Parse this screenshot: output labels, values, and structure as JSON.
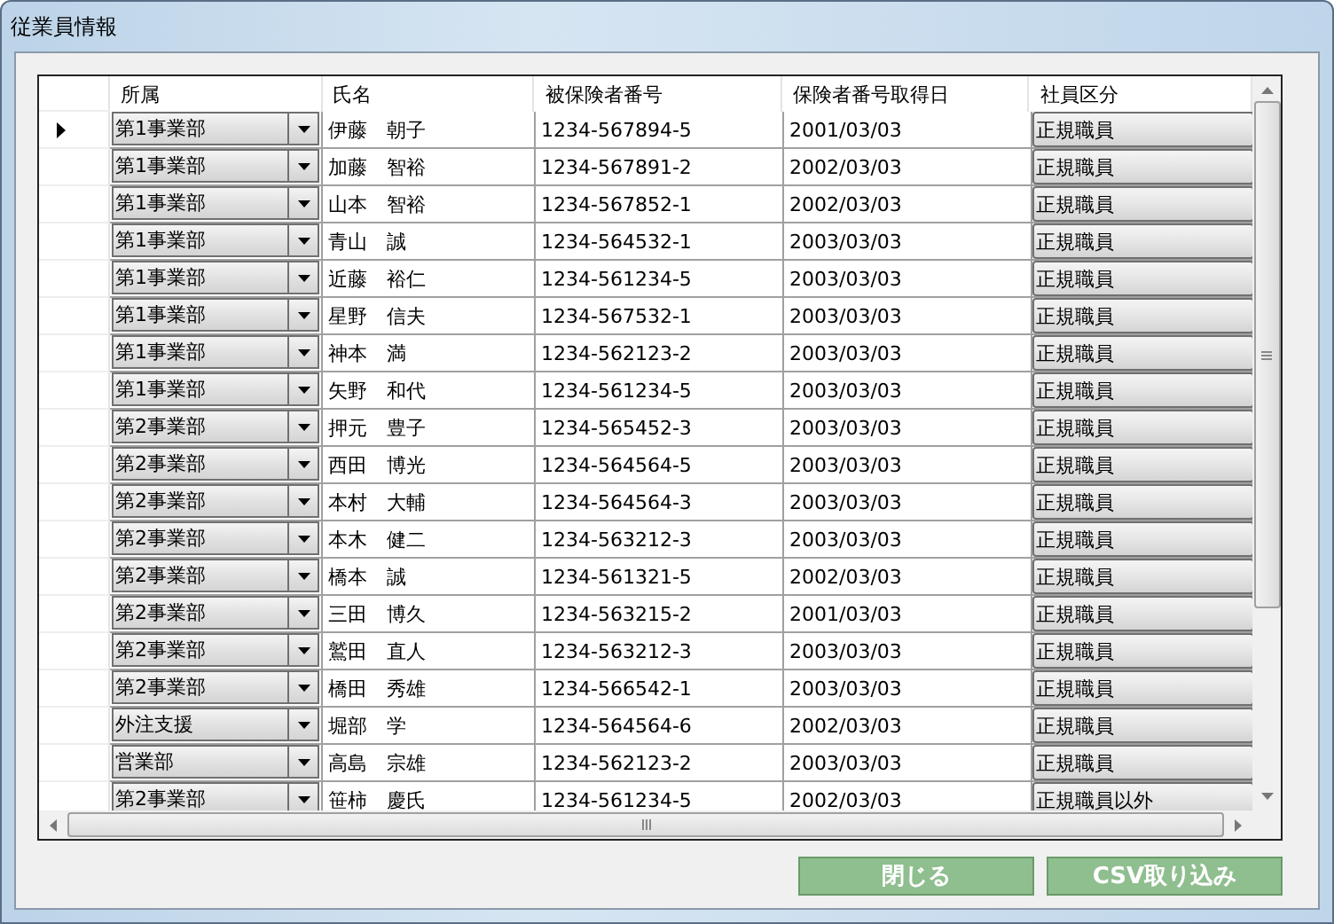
{
  "window": {
    "title": "従業員情報"
  },
  "grid": {
    "columns": [
      "所属",
      "氏名",
      "被保険者番号",
      "保険者番号取得日",
      "社員区分"
    ],
    "rows": [
      {
        "current": true,
        "department": "第1事業部",
        "name": "伊藤　朝子",
        "insured_number": "1234-567894-5",
        "acquired_date": "2001/03/03",
        "employee_type": "正規職員"
      },
      {
        "current": false,
        "department": "第1事業部",
        "name": "加藤　智裕",
        "insured_number": "1234-567891-2",
        "acquired_date": "2002/03/03",
        "employee_type": "正規職員"
      },
      {
        "current": false,
        "department": "第1事業部",
        "name": "山本　智裕",
        "insured_number": "1234-567852-1",
        "acquired_date": "2002/03/03",
        "employee_type": "正規職員"
      },
      {
        "current": false,
        "department": "第1事業部",
        "name": "青山　誠",
        "insured_number": "1234-564532-1",
        "acquired_date": "2003/03/03",
        "employee_type": "正規職員"
      },
      {
        "current": false,
        "department": "第1事業部",
        "name": "近藤　裕仁",
        "insured_number": "1234-561234-5",
        "acquired_date": "2003/03/03",
        "employee_type": "正規職員"
      },
      {
        "current": false,
        "department": "第1事業部",
        "name": "星野　信夫",
        "insured_number": "1234-567532-1",
        "acquired_date": "2003/03/03",
        "employee_type": "正規職員"
      },
      {
        "current": false,
        "department": "第1事業部",
        "name": "神本　満",
        "insured_number": "1234-562123-2",
        "acquired_date": "2003/03/03",
        "employee_type": "正規職員"
      },
      {
        "current": false,
        "department": "第1事業部",
        "name": "矢野　和代",
        "insured_number": "1234-561234-5",
        "acquired_date": "2003/03/03",
        "employee_type": "正規職員"
      },
      {
        "current": false,
        "department": "第2事業部",
        "name": "押元　豊子",
        "insured_number": "1234-565452-3",
        "acquired_date": "2003/03/03",
        "employee_type": "正規職員"
      },
      {
        "current": false,
        "department": "第2事業部",
        "name": "西田　博光",
        "insured_number": "1234-564564-5",
        "acquired_date": "2003/03/03",
        "employee_type": "正規職員"
      },
      {
        "current": false,
        "department": "第2事業部",
        "name": "本村　大輔",
        "insured_number": "1234-564564-3",
        "acquired_date": "2003/03/03",
        "employee_type": "正規職員"
      },
      {
        "current": false,
        "department": "第2事業部",
        "name": "本木　健二",
        "insured_number": "1234-563212-3",
        "acquired_date": "2003/03/03",
        "employee_type": "正規職員"
      },
      {
        "current": false,
        "department": "第2事業部",
        "name": "橋本　誠",
        "insured_number": "1234-561321-5",
        "acquired_date": "2002/03/03",
        "employee_type": "正規職員"
      },
      {
        "current": false,
        "department": "第2事業部",
        "name": "三田　博久",
        "insured_number": "1234-563215-2",
        "acquired_date": "2001/03/03",
        "employee_type": "正規職員"
      },
      {
        "current": false,
        "department": "第2事業部",
        "name": "鷲田　直人",
        "insured_number": "1234-563212-3",
        "acquired_date": "2003/03/03",
        "employee_type": "正規職員"
      },
      {
        "current": false,
        "department": "第2事業部",
        "name": "橋田　秀雄",
        "insured_number": "1234-566542-1",
        "acquired_date": "2003/03/03",
        "employee_type": "正規職員"
      },
      {
        "current": false,
        "department": "外注支援",
        "name": "堀部　学",
        "insured_number": "1234-564564-6",
        "acquired_date": "2002/03/03",
        "employee_type": "正規職員"
      },
      {
        "current": false,
        "department": "営業部",
        "name": "高島　宗雄",
        "insured_number": "1234-562123-2",
        "acquired_date": "2003/03/03",
        "employee_type": "正規職員"
      },
      {
        "current": false,
        "department": "第2事業部",
        "name": "笹柿　慶氏",
        "insured_number": "1234-561234-5",
        "acquired_date": "2002/03/03",
        "employee_type": "正規職員以外"
      }
    ]
  },
  "buttons": [
    "閉じる",
    "CSV取り込み"
  ]
}
